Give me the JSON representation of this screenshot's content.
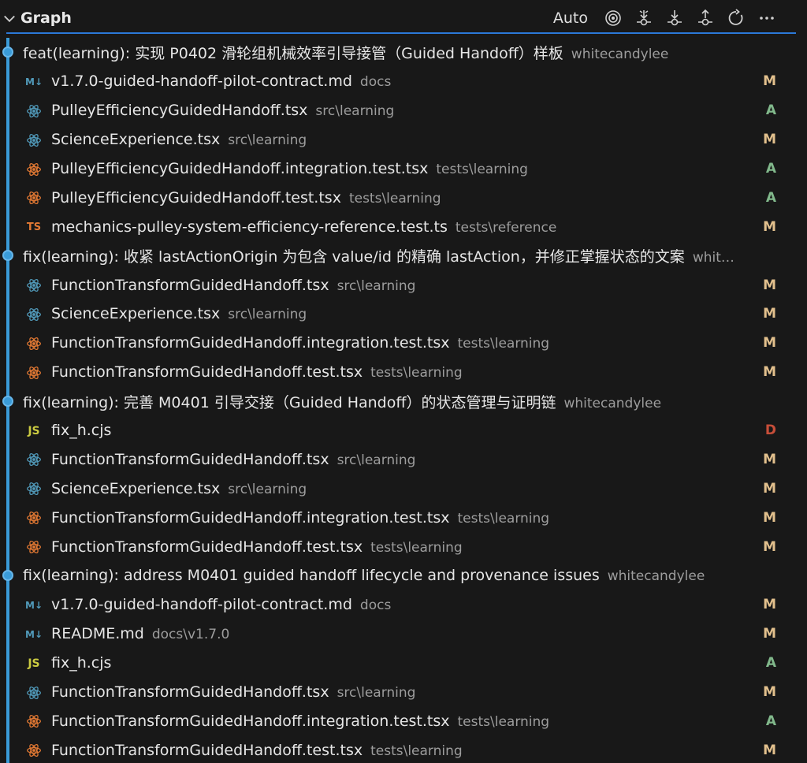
{
  "header": {
    "title": "Graph",
    "auto_label": "Auto",
    "accent": "#2b79d8"
  },
  "colors": {
    "lane": "#3a9bd8",
    "modified": "#e2c08d",
    "added": "#81b88b",
    "deleted": "#c74e39"
  },
  "rows": [
    {
      "kind": "commit",
      "message": "feat(learning): 实现 P0402 滑轮组机械效率引导接管（Guided Handoff）样板",
      "author": "whitecandylee"
    },
    {
      "kind": "file",
      "icon": "markdown-icon",
      "name": "v1.7.0-guided-handoff-pilot-contract.md",
      "dir": "docs",
      "status": "M"
    },
    {
      "kind": "file",
      "icon": "react-icon",
      "name": "PulleyEfficiencyGuidedHandoff.tsx",
      "dir": "src\\learning",
      "status": "A"
    },
    {
      "kind": "file",
      "icon": "react-icon",
      "name": "ScienceExperience.tsx",
      "dir": "src\\learning",
      "status": "M"
    },
    {
      "kind": "file",
      "icon": "react-test-icon",
      "name": "PulleyEfficiencyGuidedHandoff.integration.test.tsx",
      "dir": "tests\\learning",
      "status": "A"
    },
    {
      "kind": "file",
      "icon": "react-test-icon",
      "name": "PulleyEfficiencyGuidedHandoff.test.tsx",
      "dir": "tests\\learning",
      "status": "A"
    },
    {
      "kind": "file",
      "icon": "ts-icon",
      "name": "mechanics-pulley-system-efficiency-reference.test.ts",
      "dir": "tests\\reference",
      "status": "M"
    },
    {
      "kind": "commit",
      "message": "fix(learning): 收紧 lastActionOrigin 为包含 value/id 的精确 lastAction，并修正掌握状态的文案",
      "author": "whit…"
    },
    {
      "kind": "file",
      "icon": "react-icon",
      "name": "FunctionTransformGuidedHandoff.tsx",
      "dir": "src\\learning",
      "status": "M"
    },
    {
      "kind": "file",
      "icon": "react-icon",
      "name": "ScienceExperience.tsx",
      "dir": "src\\learning",
      "status": "M"
    },
    {
      "kind": "file",
      "icon": "react-test-icon",
      "name": "FunctionTransformGuidedHandoff.integration.test.tsx",
      "dir": "tests\\learning",
      "status": "M"
    },
    {
      "kind": "file",
      "icon": "react-test-icon",
      "name": "FunctionTransformGuidedHandoff.test.tsx",
      "dir": "tests\\learning",
      "status": "M"
    },
    {
      "kind": "commit",
      "message": "fix(learning): 完善 M0401 引导交接（Guided Handoff）的状态管理与证明链",
      "author": "whitecandylee"
    },
    {
      "kind": "file",
      "icon": "js-icon",
      "name": "fix_h.cjs",
      "dir": "",
      "status": "D"
    },
    {
      "kind": "file",
      "icon": "react-icon",
      "name": "FunctionTransformGuidedHandoff.tsx",
      "dir": "src\\learning",
      "status": "M"
    },
    {
      "kind": "file",
      "icon": "react-icon",
      "name": "ScienceExperience.tsx",
      "dir": "src\\learning",
      "status": "M"
    },
    {
      "kind": "file",
      "icon": "react-test-icon",
      "name": "FunctionTransformGuidedHandoff.integration.test.tsx",
      "dir": "tests\\learning",
      "status": "M"
    },
    {
      "kind": "file",
      "icon": "react-test-icon",
      "name": "FunctionTransformGuidedHandoff.test.tsx",
      "dir": "tests\\learning",
      "status": "M"
    },
    {
      "kind": "commit",
      "message": "fix(learning): address M0401 guided handoff lifecycle and provenance issues",
      "author": "whitecandylee"
    },
    {
      "kind": "file",
      "icon": "markdown-icon",
      "name": "v1.7.0-guided-handoff-pilot-contract.md",
      "dir": "docs",
      "status": "M"
    },
    {
      "kind": "file",
      "icon": "markdown-icon",
      "name": "README.md",
      "dir": "docs\\v1.7.0",
      "status": "M"
    },
    {
      "kind": "file",
      "icon": "js-icon",
      "name": "fix_h.cjs",
      "dir": "",
      "status": "A"
    },
    {
      "kind": "file",
      "icon": "react-icon",
      "name": "FunctionTransformGuidedHandoff.tsx",
      "dir": "src\\learning",
      "status": "M"
    },
    {
      "kind": "file",
      "icon": "react-test-icon",
      "name": "FunctionTransformGuidedHandoff.integration.test.tsx",
      "dir": "tests\\learning",
      "status": "A"
    },
    {
      "kind": "file",
      "icon": "react-test-icon",
      "name": "FunctionTransformGuidedHandoff.test.tsx",
      "dir": "tests\\learning",
      "status": "M"
    }
  ]
}
